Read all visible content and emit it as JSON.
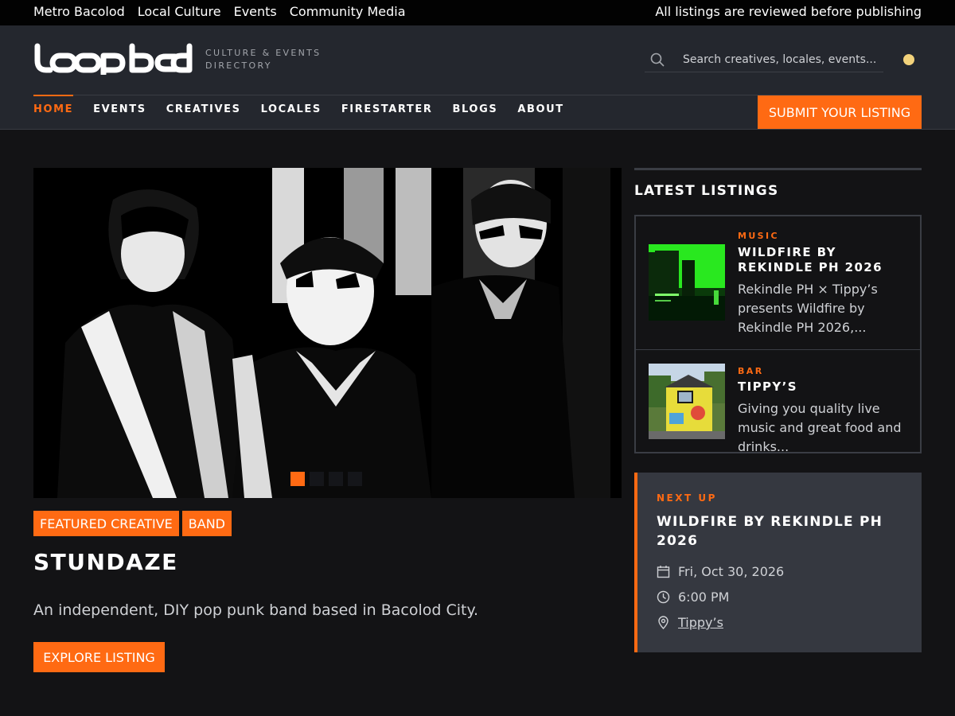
{
  "topbar": {
    "links": [
      "Metro Bacolod",
      "Local Culture",
      "Events",
      "Community Media"
    ],
    "notice": "All listings are reviewed before publishing"
  },
  "header": {
    "logo_text": "loopbcd",
    "tagline": "CULTURE & EVENTS DIRECTORY",
    "search_placeholder": "Search creatives, locales, events..."
  },
  "nav": {
    "items": [
      {
        "label": "HOME",
        "active": true
      },
      {
        "label": "EVENTS",
        "active": false
      },
      {
        "label": "CREATIVES",
        "active": false
      },
      {
        "label": "LOCALES",
        "active": false
      },
      {
        "label": "FIRESTARTER",
        "active": false
      },
      {
        "label": "BLOGS",
        "active": false
      },
      {
        "label": "ABOUT",
        "active": false
      }
    ],
    "submit_label": "SUBMIT YOUR LISTING"
  },
  "featured": {
    "carousel_slides": 4,
    "active_slide": 1,
    "tags": [
      "FEATURED CREATIVE",
      "BAND"
    ],
    "title": "STUNDAZE",
    "description": "An independent, DIY pop punk band based in Bacolod City.",
    "cta": "EXPLORE LISTING"
  },
  "latest": {
    "title": "LATEST LISTINGS",
    "items": [
      {
        "category": "MUSIC",
        "name": "WILDFIRE BY REKINDLE PH 2026",
        "description": "Rekindle PH × Tippy’s presents Wildfire by Rekindle PH 2026,..."
      },
      {
        "category": "BAR",
        "name": "TIPPY’S",
        "description": "Giving you quality live music and great food and drinks..."
      }
    ]
  },
  "next_up": {
    "label": "NEXT UP",
    "title": "WILDFIRE BY REKINDLE PH 2026",
    "date": "Fri, Oct 30, 2026",
    "time": "6:00 PM",
    "venue": "Tippy’s"
  },
  "colors": {
    "accent": "#ff6a13",
    "background": "#131315",
    "header": "#24272e",
    "topbar": "#020202",
    "card": "#353840"
  }
}
